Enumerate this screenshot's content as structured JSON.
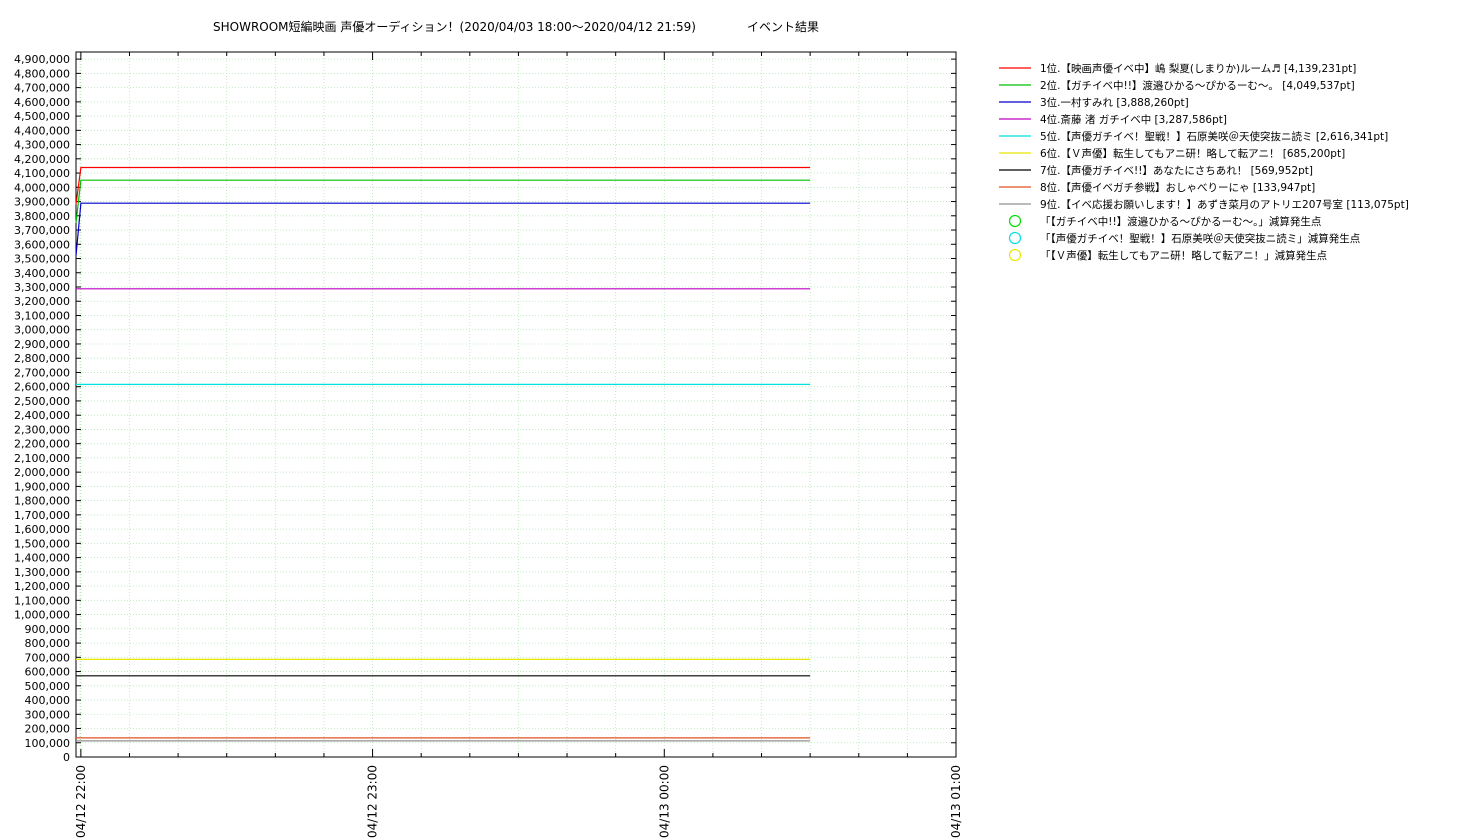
{
  "chart_data": {
    "type": "line",
    "title": "SHOWROOM短編映画 声優オーディション！(2020/04/03 18:00～2020/04/12 21:59)",
    "subtitle": "イベント結果",
    "ylim": [
      0,
      4950000
    ],
    "y_ticks": [
      0,
      100000,
      200000,
      300000,
      400000,
      500000,
      600000,
      700000,
      800000,
      900000,
      1000000,
      1100000,
      1200000,
      1300000,
      1400000,
      1500000,
      1600000,
      1700000,
      1800000,
      1900000,
      2000000,
      2100000,
      2200000,
      2300000,
      2400000,
      2500000,
      2600000,
      2700000,
      2800000,
      2900000,
      3000000,
      3100000,
      3200000,
      3300000,
      3400000,
      3500000,
      3600000,
      3700000,
      3800000,
      3900000,
      4000000,
      4100000,
      4200000,
      4300000,
      4400000,
      4500000,
      4600000,
      4700000,
      4800000,
      4900000
    ],
    "y_tick_labels": [
      "0",
      "100,000",
      "200,000",
      "300,000",
      "400,000",
      "500,000",
      "600,000",
      "700,000",
      "800,000",
      "900,000",
      "1,000,000",
      "1,100,000",
      "1,200,000",
      "1,300,000",
      "1,400,000",
      "1,500,000",
      "1,600,000",
      "1,700,000",
      "1,800,000",
      "1,900,000",
      "2,000,000",
      "2,100,000",
      "2,200,000",
      "2,300,000",
      "2,400,000",
      "2,500,000",
      "2,600,000",
      "2,700,000",
      "2,800,000",
      "2,900,000",
      "3,000,000",
      "3,100,000",
      "3,200,000",
      "3,300,000",
      "3,400,000",
      "3,500,000",
      "3,600,000",
      "3,700,000",
      "3,800,000",
      "3,900,000",
      "4,000,000",
      "4,100,000",
      "4,200,000",
      "4,300,000",
      "4,400,000",
      "4,500,000",
      "4,600,000",
      "4,700,000",
      "4,800,000",
      "4,900,000"
    ],
    "xlim": [
      "2020-04-12 21:59",
      "2020-04-13 01:00"
    ],
    "x_ticks": [
      "04/12 22:00",
      "04/12 23:00",
      "04/13 00:00",
      "04/13 01:00"
    ],
    "grid": true,
    "legend_position": "right",
    "series": [
      {
        "name": "1位.【映画声優イベ中】嶋 梨夏(しまりか)ルーム♬ [4,139,231pt]",
        "color": "#ff0000",
        "x": [
          "2020-04-12 21:59",
          "2020-04-12 22:00",
          "2020-04-13 00:30"
        ],
        "values": [
          3880000,
          4139231,
          4139231
        ]
      },
      {
        "name": "2位.【ガチイベ中!!】渡邉ひかる～ぴかるーむ～。 [4,049,537pt]",
        "color": "#00c000",
        "x": [
          "2020-04-12 21:59",
          "2020-04-12 22:00",
          "2020-04-13 00:30"
        ],
        "values": [
          3750000,
          4049537,
          4049537
        ]
      },
      {
        "name": "3位.一村すみれ [3,888,260pt]",
        "color": "#0000cc",
        "x": [
          "2020-04-12 21:59",
          "2020-04-12 22:00",
          "2020-04-13 00:30"
        ],
        "values": [
          3520000,
          3888260,
          3888260
        ]
      },
      {
        "name": "4位.斎藤 渚 ガチイベ中 [3,287,586pt]",
        "color": "#c000c0",
        "x": [
          "2020-04-12 21:59",
          "2020-04-13 00:30"
        ],
        "values": [
          3287586,
          3287586
        ]
      },
      {
        "name": "5位.【声優ガチイベ！聖戦！】石原美咲＠天使突抜ニ読ミ [2,616,341pt]",
        "color": "#00e0e0",
        "x": [
          "2020-04-12 21:59",
          "2020-04-13 00:30"
        ],
        "values": [
          2616341,
          2616341
        ]
      },
      {
        "name": "6位.【Ｖ声優】転生してもアニ研！略して転アニ！ [685,200pt]",
        "color": "#e8e800",
        "x": [
          "2020-04-12 21:59",
          "2020-04-13 00:30"
        ],
        "values": [
          685200,
          685200
        ]
      },
      {
        "name": "7位.【声優ガチイベ!!】あなたにさちあれ！ [569,952pt]",
        "color": "#000000",
        "x": [
          "2020-04-12 21:59",
          "2020-04-13 00:30"
        ],
        "values": [
          569952,
          569952
        ]
      },
      {
        "name": "8位.【声優イベガチ参戦】おしゃべりーにゃ [133,947pt]",
        "color": "#e05020",
        "x": [
          "2020-04-12 21:59",
          "2020-04-13 00:30"
        ],
        "values": [
          133947,
          133947
        ]
      },
      {
        "name": "9位.【イベ応援お願いします！】あずき菜月のアトリエ207号室 [113,075pt]",
        "color": "#909090",
        "x": [
          "2020-04-12 21:59",
          "2020-04-13 00:30"
        ],
        "values": [
          113075,
          113075
        ]
      }
    ],
    "marker_legend": [
      {
        "label": "「【ガチイベ中!!】渡邉ひかる～ぴかるーむ～。」減算発生点",
        "color": "#00e000"
      },
      {
        "label": "「【声優ガチイベ！聖戦！】石原美咲＠天使突抜ニ読ミ」減算発生点",
        "color": "#00e0e0"
      },
      {
        "label": "「【Ｖ声優】転生してもアニ研！略して転アニ！」減算発生点",
        "color": "#e8e800"
      }
    ]
  }
}
